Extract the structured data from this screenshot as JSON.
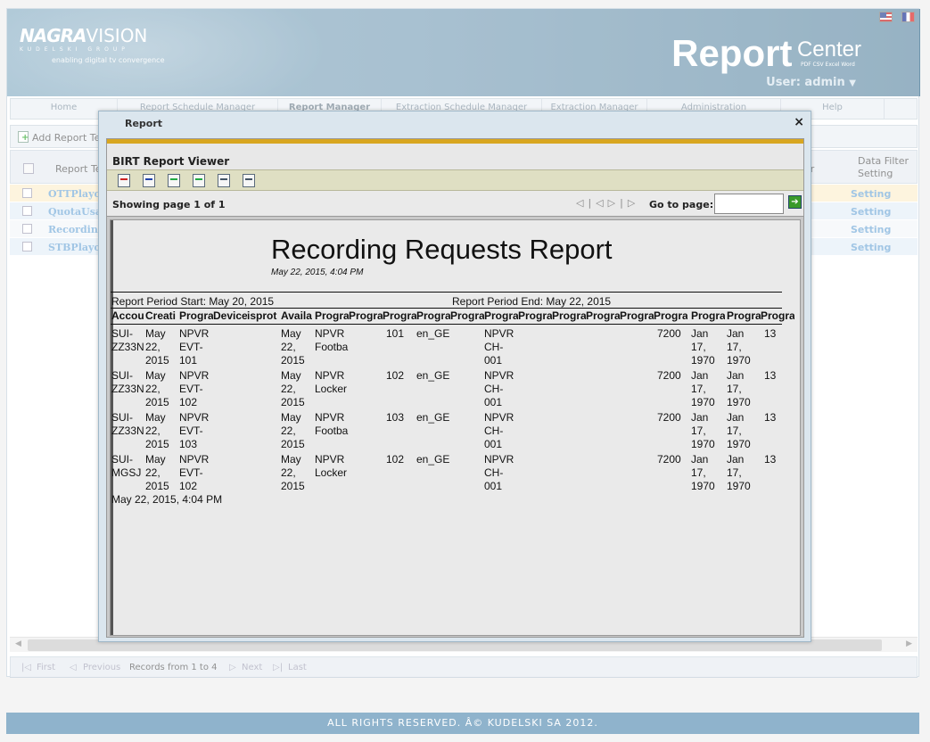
{
  "header": {
    "logo_main_a": "NAGRA",
    "logo_main_b": "VISION",
    "logo_group": "KUDELSKI GROUP",
    "logo_tagline": "enabling digital tv convergence",
    "product_big": "Report",
    "product_small": "Center",
    "product_formats": "PDF CSV Excel Word",
    "user_label": "User: admin",
    "user_menu_icon": "caret-down-icon"
  },
  "nav": {
    "items": [
      {
        "label": "Home"
      },
      {
        "label": "Report Schedule Manager"
      },
      {
        "label": "Report Manager",
        "active": true
      },
      {
        "label": "Extraction Schedule Manager"
      },
      {
        "label": "Extraction Manager"
      },
      {
        "label": "Administration"
      },
      {
        "label": "Help"
      }
    ]
  },
  "toolbar": {
    "add_label": "Add Report Ter"
  },
  "grid": {
    "col_name": "Report Ter",
    "col_mid": "er",
    "col_filter_line1": "Data Filter",
    "col_filter_line2": "Setting",
    "rows": [
      {
        "name": "OTTPlayou",
        "setting": "Setting",
        "highlight": "#fdf0d2"
      },
      {
        "name": "QuotaUsac",
        "setting": "Setting",
        "highlight": "#e6f0f8"
      },
      {
        "name": "Recording",
        "setting": "Setting",
        "highlight": "#f4f7fa"
      },
      {
        "name": "STBPlayou",
        "setting": "Setting",
        "highlight": "#e6f0f8"
      }
    ]
  },
  "pager": {
    "first": "First",
    "previous": "Previous",
    "records": "Records from 1 to 4",
    "next": "Next",
    "last": "Last"
  },
  "footer": {
    "text": "ALL RIGHTS RESERVED. Â© KUDELSKI SA 2012."
  },
  "dialog": {
    "title": "Report",
    "close_glyph": "×",
    "viewer_title": "BIRT Report Viewer",
    "tools": [
      "toc-icon",
      "parameters-icon",
      "export-data-icon",
      "export-report-icon",
      "print-icon",
      "print-server-icon"
    ],
    "showing_label": "Showing page  1  of  1",
    "goto_label": "Go to page:",
    "goto_value": "",
    "go_glyph": "➔"
  },
  "report": {
    "title": "Recording Requests Report",
    "generated": "May 22, 2015, 4:04 PM",
    "period_start": "Report Period Start:    May 20, 2015",
    "period_end": "Report Period End:    May 22, 2015",
    "footer_date": "May 22, 2015, 4:04 PM",
    "columns": [
      "Accou",
      "Creati",
      "Progra",
      "Device",
      "isprot",
      "Availa",
      "Progra",
      "Progra",
      "Progra",
      "Progra",
      "Progra",
      "Progra",
      "Progra",
      "Progra",
      "Progra",
      "Progra",
      "Progra",
      "Progra",
      "Progra",
      "Progra"
    ],
    "rows": [
      [
        "SUI-\nZZ33N",
        "May\n22,\n2015",
        "NPVR\nEVT-\n101",
        "",
        "",
        "May\n22,\n2015",
        "NPVR\nFootba",
        "",
        "101",
        "en_GE",
        "",
        "NPVR\nCH-\n001",
        "",
        "",
        "",
        "",
        "7200",
        "Jan\n17,\n1970",
        "Jan\n17,\n1970",
        "13"
      ],
      [
        "SUI-\nZZ33N",
        "May\n22,\n2015",
        "NPVR\nEVT-\n102",
        "",
        "",
        "May\n22,\n2015",
        "NPVR\nLocker",
        "",
        "102",
        "en_GE",
        "",
        "NPVR\nCH-\n001",
        "",
        "",
        "",
        "",
        "7200",
        "Jan\n17,\n1970",
        "Jan\n17,\n1970",
        "13"
      ],
      [
        "SUI-\nZZ33N",
        "May\n22,\n2015",
        "NPVR\nEVT-\n103",
        "",
        "",
        "May\n22,\n2015",
        "NPVR\nFootba",
        "",
        "103",
        "en_GE",
        "",
        "NPVR\nCH-\n001",
        "",
        "",
        "",
        "",
        "7200",
        "Jan\n17,\n1970",
        "Jan\n17,\n1970",
        "13"
      ],
      [
        "SUI-\nMGSJ",
        "May\n22,\n2015",
        "NPVR\nEVT-\n102",
        "",
        "",
        "May\n22,\n2015",
        "NPVR\nLocker",
        "",
        "102",
        "en_GE",
        "",
        "NPVR\nCH-\n001",
        "",
        "",
        "",
        "",
        "7200",
        "Jan\n17,\n1970",
        "Jan\n17,\n1970",
        "13"
      ]
    ]
  }
}
